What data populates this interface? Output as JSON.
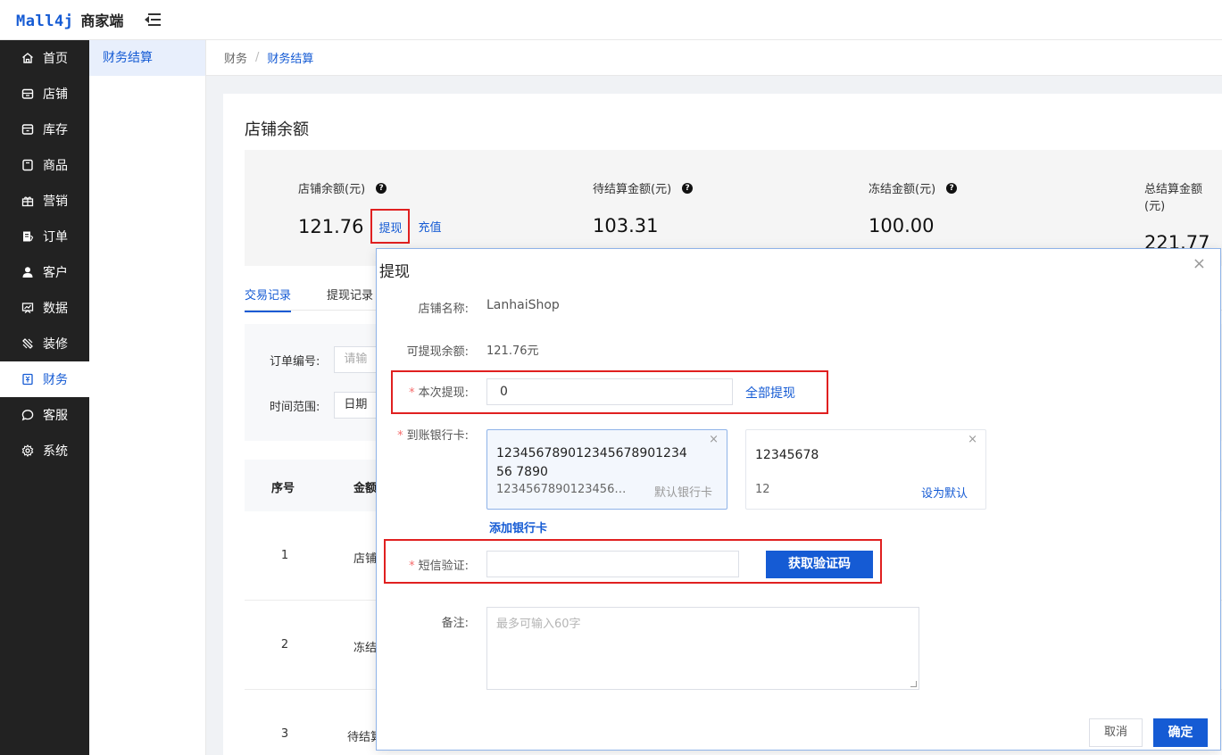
{
  "header": {
    "logo_brand": "Mall4j",
    "logo_text": "商家端"
  },
  "sidebar": {
    "items": [
      {
        "label": "首页",
        "icon": "home-icon"
      },
      {
        "label": "店铺",
        "icon": "shop-icon"
      },
      {
        "label": "库存",
        "icon": "inventory-icon"
      },
      {
        "label": "商品",
        "icon": "product-icon"
      },
      {
        "label": "营销",
        "icon": "gift-icon"
      },
      {
        "label": "订单",
        "icon": "order-icon"
      },
      {
        "label": "客户",
        "icon": "user-icon"
      },
      {
        "label": "数据",
        "icon": "chart-icon"
      },
      {
        "label": "装修",
        "icon": "decoration-icon"
      },
      {
        "label": "财务",
        "icon": "finance-icon",
        "active": true
      },
      {
        "label": "客服",
        "icon": "chat-icon"
      },
      {
        "label": "系统",
        "icon": "gear-icon"
      }
    ]
  },
  "subnav": {
    "item": "财务结算"
  },
  "breadcrumb": {
    "parent": "财务",
    "separator": "/",
    "current": "财务结算"
  },
  "page": {
    "title": "店铺余额",
    "stats": [
      {
        "label": "店铺余额(元)",
        "value": "121.76"
      },
      {
        "label": "待结算金额(元)",
        "value": "103.31"
      },
      {
        "label": "冻结金额(元)",
        "value": "100.00"
      },
      {
        "label": "总结算金额(元)",
        "value": "221.77"
      }
    ],
    "withdraw_link": "提现",
    "recharge_link": "充值",
    "tabs": [
      "交易记录",
      "提现记录"
    ],
    "filters": {
      "order_label": "订单编号:",
      "order_placeholder": "请输",
      "time_label": "时间范围:",
      "time_placeholder": "日期"
    },
    "table": {
      "headers": [
        "序号",
        "金额"
      ],
      "rows": [
        {
          "seq": "1",
          "amount": "店铺"
        },
        {
          "seq": "2",
          "amount": "冻结"
        },
        {
          "seq": "3",
          "amount": "待结算"
        }
      ]
    }
  },
  "modal": {
    "title": "提现",
    "close": "×",
    "shop_name_label": "店铺名称:",
    "shop_name": "LanhaiShop",
    "available_label": "可提现余额:",
    "available": "121.76元",
    "amount_label": "本次提现:",
    "amount_value": "0",
    "withdraw_all": "全部提现",
    "bank_label": "到账银行卡:",
    "bank_cards": [
      {
        "number": "12345678901234567890123456 7890",
        "sub": "12345678901234567...",
        "tag": "默认银行卡"
      },
      {
        "number": "12345678",
        "sub": "12",
        "tag": "设为默认"
      }
    ],
    "card_close": "×",
    "add_card": "添加银行卡",
    "sms_label": "短信验证:",
    "sms_value": "",
    "get_code": "获取验证码",
    "remark_label": "备注:",
    "remark_placeholder": "最多可输入60字",
    "cancel": "取消",
    "confirm": "确定"
  },
  "colors": {
    "primary": "#155bd4",
    "sidebar_bg": "#222222",
    "highlight": "#e02020"
  }
}
